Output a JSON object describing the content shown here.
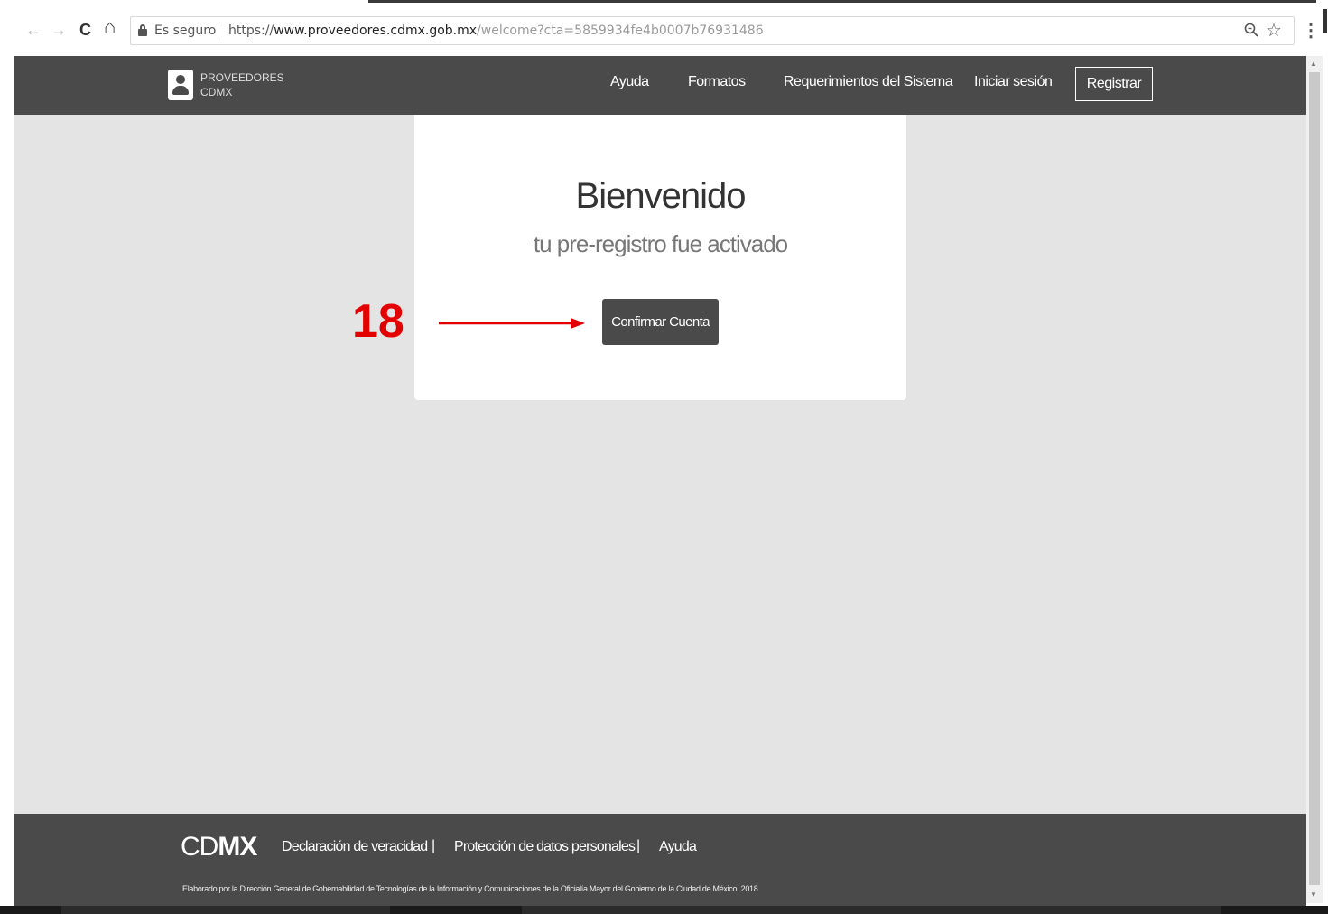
{
  "browser": {
    "back_icon": "back-arrow-icon",
    "back_glyph": "←",
    "forward_glyph": "→",
    "reload_glyph": "C",
    "home_glyph": "⌂",
    "secure_label": "Es seguro",
    "url_scheme": "https://",
    "url_host": "www.proveedores.cdmx.gob.mx",
    "url_path": "/welcome?cta=5859934fe4b0007b76931486",
    "zoom_glyph": "🔍",
    "star_glyph": "☆",
    "menu_glyph": "⋮"
  },
  "header": {
    "logo_line1": "PROVEEDORES",
    "logo_line2": "CDMX",
    "nav": [
      "Ayuda",
      "Formatos",
      "Requerimientos del Sistema",
      "Iniciar sesión"
    ],
    "register_label": "Registrar",
    "background": "#4a4a4a"
  },
  "card": {
    "title": "Bienvenido",
    "subtitle": "tu pre-registro fue activado",
    "confirm_label": "Confirmar Cuenta"
  },
  "annotation": {
    "number": "18",
    "color": "#e20000"
  },
  "footer": {
    "logo_thin": "CD",
    "logo_bold": "MX",
    "links": [
      "Declaración de veracidad",
      "Protección de datos personales",
      "Ayuda"
    ],
    "separator": "|",
    "credit": "Elaborado por la Dirección General de Gobernabilidad de Tecnologías de la Información y Comunicaciones de la Oficialía Mayor del Gobierno de la Ciudad de México. 2018"
  }
}
